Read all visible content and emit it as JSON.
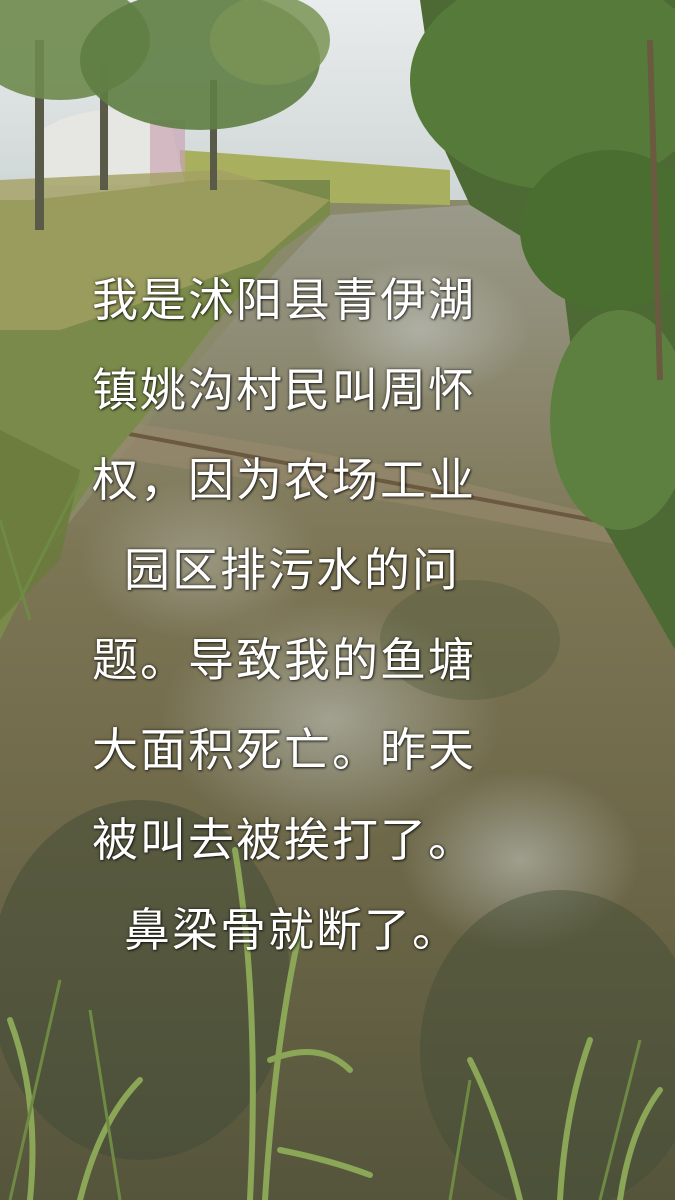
{
  "caption": {
    "lines": [
      "我是沭阳县青伊湖",
      "镇姚沟村民叫周怀",
      "权，因为农场工业",
      "园区排污水的问",
      "题。导致我的鱼塘",
      "大面积死亡。昨天",
      "被叫去被挨打了。",
      "鼻梁骨就断了。"
    ]
  },
  "colors": {
    "sky": "#dfe3e4",
    "water": "#6f6a4c",
    "vegetation": "#5f7a3e",
    "caption_text": "#ffffff"
  }
}
